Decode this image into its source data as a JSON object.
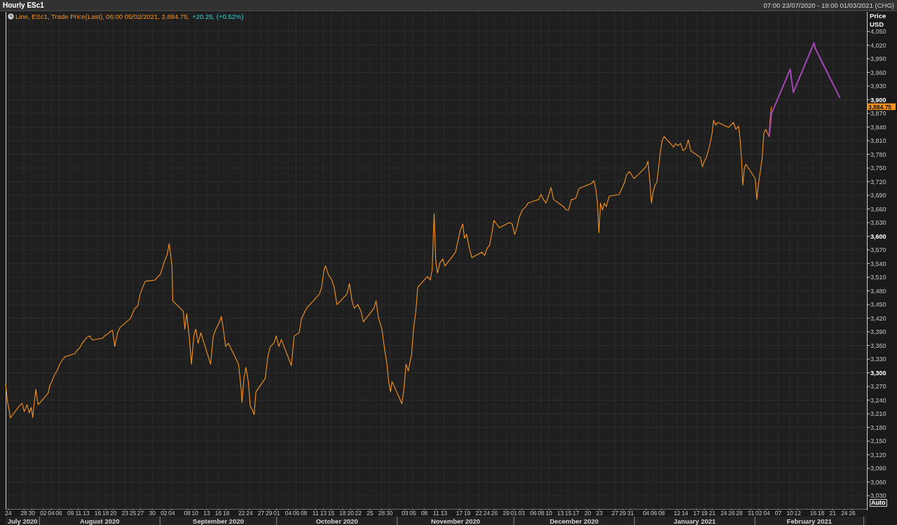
{
  "window": {
    "title": "Hourly ESc1",
    "date_range": "07:00 23/07/2020 - 19:00 01/03/2021 (CHG)"
  },
  "chart": {
    "legend": {
      "series_text": "Line, ESc1, Trade Price(Last), 06:00 05/02/2021, 3,884.75,",
      "change_text": "+20.25, (+0.52%)"
    },
    "y_axis": {
      "title": "Price",
      "unit": "USD",
      "scale_button": "Auto"
    },
    "last_price_tag": "3,884.75",
    "month_axis": [
      "July 2020",
      "August 2020",
      "September 2020",
      "October 2020",
      "November 2020",
      "December 2020",
      "January 2021",
      "February 2021"
    ],
    "chart_data": {
      "type": "line",
      "grid": true,
      "x": [
        "2020-07-23 07:00",
        "2020-07-23 19:00",
        "2020-07-24 05:00",
        "2020-07-24 12:00",
        "2020-07-26 19:00",
        "2020-07-27 12:00",
        "2020-07-28 02:00",
        "2020-07-28 19:00",
        "2020-07-29 09:00",
        "2020-07-29 21:00",
        "2020-07-30 07:00",
        "2020-07-30 17:00",
        "2020-07-31 02:00",
        "2020-07-31 07:00",
        "2020-07-31 16:00",
        "2020-08-03 05:00",
        "2020-08-03 17:00",
        "2020-08-04 05:00",
        "2020-08-04 21:00",
        "2020-08-05 12:00",
        "2020-08-06 05:00",
        "2020-08-06 19:00",
        "2020-08-07 12:00",
        "2020-08-10 02:00",
        "2020-08-10 17:00",
        "2020-08-11 09:00",
        "2020-08-12 00:00",
        "2020-08-12 17:00",
        "2020-08-13 07:00",
        "2020-08-13 21:00",
        "2020-08-14 14:00",
        "2020-08-17 05:00",
        "2020-08-17 21:00",
        "2020-08-18 12:00",
        "2020-08-19 02:00",
        "2020-08-19 19:00",
        "2020-08-20 09:00",
        "2020-08-21 02:00",
        "2020-08-21 16:00",
        "2020-08-24 09:00",
        "2020-08-25 00:00",
        "2020-08-25 14:00",
        "2020-08-26 07:00",
        "2020-08-26 21:00",
        "2020-08-27 14:00",
        "2020-08-28 05:00",
        "2020-08-30 19:00",
        "2020-08-31 12:00",
        "2020-09-01 02:00",
        "2020-09-02 00:00",
        "2020-09-02 19:00",
        "2020-09-03 09:00",
        "2020-09-04 02:00",
        "2020-09-04 07:00",
        "2020-09-07 00:00",
        "2020-09-07 09:00",
        "2020-09-07 21:00",
        "2020-09-08 12:00",
        "2020-09-09 02:00",
        "2020-09-09 17:00",
        "2020-09-10 05:00",
        "2020-09-10 19:00",
        "2020-09-11 12:00",
        "2020-09-14 00:00",
        "2020-09-14 17:00",
        "2020-09-15 09:00",
        "2020-09-16 07:00",
        "2020-09-16 19:00",
        "2020-09-17 07:00",
        "2020-09-17 21:00",
        "2020-09-18 14:00",
        "2020-09-21 05:00",
        "2020-09-21 21:00",
        "2020-09-22 02:00",
        "2020-09-22 14:00",
        "2020-09-23 02:00",
        "2020-09-23 17:00",
        "2020-09-24 05:00",
        "2020-09-24 17:00",
        "2020-09-25 05:00",
        "2020-09-25 16:00",
        "2020-09-28 02:00",
        "2020-09-28 17:00",
        "2020-09-29 09:00",
        "2020-09-30 07:00",
        "2020-09-30 21:00",
        "2020-10-01 14:00",
        "2020-10-02 05:00",
        "2020-10-04 19:00",
        "2020-10-05 12:00",
        "2020-10-06 19:00",
        "2020-10-07 09:00",
        "2020-10-08 17:00",
        "2020-10-12 00:00",
        "2020-10-12 14:00",
        "2020-10-13 05:00",
        "2020-10-13 14:00",
        "2020-10-14 07:00",
        "2020-10-15 05:00",
        "2020-10-15 19:00",
        "2020-10-16 12:00",
        "2020-10-19 02:00",
        "2020-10-19 17:00",
        "2020-10-20 09:00",
        "2020-10-21 00:00",
        "2020-10-21 21:00",
        "2020-10-22 17:00",
        "2020-10-23 07:00",
        "2020-10-26 00:00",
        "2020-10-26 14:00",
        "2020-10-27 05:00",
        "2020-10-28 02:00",
        "2020-10-28 19:00",
        "2020-10-29 09:00",
        "2020-10-29 19:00",
        "2020-10-30 07:00",
        "2020-10-30 16:00",
        "2020-11-02 05:00",
        "2020-11-02 17:00",
        "2020-11-03 07:00",
        "2020-11-03 21:00",
        "2020-11-04 17:00",
        "2020-11-05 05:00",
        "2020-11-05 19:00",
        "2020-11-06 07:00",
        "2020-11-08 19:00",
        "2020-11-09 12:00",
        "2020-11-10 00:00",
        "2020-11-10 12:00",
        "2020-11-10 21:00",
        "2020-11-11 09:00",
        "2020-11-12 00:00",
        "2020-11-12 17:00",
        "2020-11-13 07:00",
        "2020-11-16 00:00",
        "2020-11-16 14:00",
        "2020-11-17 05:00",
        "2020-11-17 21:00",
        "2020-11-18 07:00",
        "2020-11-18 21:00",
        "2020-11-19 14:00",
        "2020-11-20 05:00",
        "2020-11-22 19:00",
        "2020-11-23 12:00",
        "2020-11-24 02:00",
        "2020-11-24 19:00",
        "2020-11-25 07:00",
        "2020-11-25 21:00",
        "2020-11-26 14:00",
        "2020-11-27 07:00",
        "2020-11-29 19:00",
        "2020-11-30 14:00",
        "2020-12-01 05:00",
        "2020-12-01 19:00",
        "2020-12-02 09:00",
        "2020-12-03 05:00",
        "2020-12-04 02:00",
        "2020-12-04 16:00",
        "2020-12-07 09:00",
        "2020-12-08 00:00",
        "2020-12-08 14:00",
        "2020-12-09 07:00",
        "2020-12-09 21:00",
        "2020-12-10 14:00",
        "2020-12-11 05:00",
        "2020-12-13 19:00",
        "2020-12-14 12:00",
        "2020-12-15 02:00",
        "2020-12-15 19:00",
        "2020-12-16 09:00",
        "2020-12-17 00:00",
        "2020-12-17 17:00",
        "2020-12-18 07:00",
        "2020-12-21 00:00",
        "2020-12-21 14:00",
        "2020-12-22 02:00",
        "2020-12-22 12:00",
        "2020-12-22 21:00",
        "2020-12-23 07:00",
        "2020-12-23 19:00",
        "2020-12-24 07:00",
        "2020-12-24 19:00",
        "2020-12-25 12:00",
        "2020-12-28 02:00",
        "2020-12-28 17:00",
        "2020-12-29 09:00",
        "2020-12-30 00:00",
        "2020-12-30 17:00",
        "2020-12-31 07:00",
        "2020-12-31 21:00",
        "2021-01-01 14:00",
        "2021-01-04 00:00",
        "2021-01-04 12:00",
        "2021-01-05 00:00",
        "2021-01-05 09:00",
        "2021-01-05 19:00",
        "2021-01-06 07:00",
        "2021-01-06 19:00",
        "2021-01-07 05:00",
        "2021-01-07 17:00",
        "2021-01-08 05:00",
        "2021-01-08 16:00",
        "2021-01-11 02:00",
        "2021-01-11 14:00",
        "2021-01-12 05:00",
        "2021-01-12 21:00",
        "2021-01-13 12:00",
        "2021-01-14 05:00",
        "2021-01-14 21:00",
        "2021-01-15 12:00",
        "2021-01-18 00:00",
        "2021-01-18 12:00",
        "2021-01-19 00:00",
        "2021-01-19 12:00",
        "2021-01-20 00:00",
        "2021-01-20 12:00",
        "2021-01-21 00:00",
        "2021-01-21 09:00",
        "2021-01-21 21:00",
        "2021-01-22 14:00",
        "2021-01-25 05:00",
        "2021-01-25 21:00",
        "2021-01-26 12:00",
        "2021-01-27 02:00",
        "2021-01-27 19:00",
        "2021-01-28 05:00",
        "2021-01-28 14:00",
        "2021-01-28 21:00",
        "2021-01-29 07:00",
        "2021-01-29 16:00",
        "2021-02-01 02:00",
        "2021-02-01 12:00",
        "2021-02-01 21:00",
        "2021-02-02 09:00",
        "2021-02-02 21:00",
        "2021-02-03 07:00",
        "2021-02-03 19:00",
        "2021-02-04 05:00",
        "2021-02-04 15:00",
        "2021-02-04 23:00",
        "2021-02-05 06:00",
        "2021-02-10 02:00",
        "2021-02-10 21:00",
        "2021-02-16 05:00",
        "2021-02-16 12:00",
        "2021-02-22 21:00"
      ],
      "series": [
        {
          "color": "#f7931e",
          "values": [
            3276,
            3235,
            3219,
            3201,
            3227,
            3233,
            3215,
            3230,
            3212,
            3224,
            3202,
            3239,
            3264,
            3248,
            3230,
            3255,
            3273,
            3281,
            3296,
            3304,
            3319,
            3327,
            3335,
            3342,
            3350,
            3355,
            3365,
            3373,
            3378,
            3381,
            3372,
            3376,
            3382,
            3385,
            3390,
            3393,
            3358,
            3388,
            3399,
            3419,
            3432,
            3442,
            3447,
            3473,
            3488,
            3501,
            3504,
            3512,
            3516,
            3542,
            3558,
            3584,
            3535,
            3458,
            3435,
            3396,
            3430,
            3381,
            3319,
            3381,
            3396,
            3365,
            3388,
            3319,
            3381,
            3396,
            3412,
            3424,
            3396,
            3358,
            3365,
            3319,
            3265,
            3235,
            3288,
            3312,
            3281,
            3227,
            3219,
            3208,
            3258,
            3288,
            3335,
            3358,
            3365,
            3381,
            3358,
            3373,
            3316,
            3381,
            3388,
            3419,
            3442,
            3473,
            3488,
            3527,
            3535,
            3516,
            3504,
            3488,
            3450,
            3473,
            3496,
            3458,
            3442,
            3450,
            3435,
            3412,
            3442,
            3458,
            3419,
            3396,
            3350,
            3319,
            3281,
            3258,
            3281,
            3232,
            3265,
            3319,
            3304,
            3342,
            3396,
            3435,
            3488,
            3512,
            3504,
            3527,
            3650,
            3550,
            3519,
            3542,
            3550,
            3535,
            3565,
            3588,
            3612,
            3627,
            3596,
            3604,
            3573,
            3553,
            3565,
            3558,
            3573,
            3581,
            3604,
            3635,
            3627,
            3619,
            3630,
            3627,
            3604,
            3619,
            3642,
            3658,
            3665,
            3673,
            3681,
            3692,
            3681,
            3673,
            3688,
            3707,
            3681,
            3665,
            3658,
            3658,
            3681,
            3681,
            3685,
            3704,
            3707,
            3716,
            3722,
            3704,
            3673,
            3608,
            3673,
            3658,
            3673,
            3665,
            3688,
            3692,
            3704,
            3716,
            3735,
            3742,
            3735,
            3727,
            3732,
            3753,
            3765,
            3719,
            3673,
            3696,
            3712,
            3719,
            3750,
            3788,
            3812,
            3819,
            3796,
            3804,
            3799,
            3804,
            3788,
            3793,
            3812,
            3788,
            3773,
            3753,
            3765,
            3773,
            3788,
            3804,
            3827,
            3855,
            3845,
            3850,
            3839,
            3845,
            3850,
            3835,
            3842,
            3812,
            3765,
            3712,
            3750,
            3758,
            3727,
            3681,
            3712,
            3742,
            3773,
            3827,
            3835,
            3827,
            3819,
            3861,
            3884.75,
            null,
            null,
            null,
            null,
            null
          ]
        },
        {
          "color": "#a547b8",
          "values": [
            null,
            null,
            null,
            null,
            null,
            null,
            null,
            null,
            null,
            null,
            null,
            null,
            null,
            null,
            null,
            null,
            null,
            null,
            null,
            null,
            null,
            null,
            null,
            null,
            null,
            null,
            null,
            null,
            null,
            null,
            null,
            null,
            null,
            null,
            null,
            null,
            null,
            null,
            null,
            null,
            null,
            null,
            null,
            null,
            null,
            null,
            null,
            null,
            null,
            null,
            null,
            null,
            null,
            null,
            null,
            null,
            null,
            null,
            null,
            null,
            null,
            null,
            null,
            null,
            null,
            null,
            null,
            null,
            null,
            null,
            null,
            null,
            null,
            null,
            null,
            null,
            null,
            null,
            null,
            null,
            null,
            null,
            null,
            null,
            null,
            null,
            null,
            null,
            null,
            null,
            null,
            null,
            null,
            null,
            null,
            null,
            null,
            null,
            null,
            null,
            null,
            null,
            null,
            null,
            null,
            null,
            null,
            null,
            null,
            null,
            null,
            null,
            null,
            null,
            null,
            null,
            null,
            null,
            null,
            null,
            null,
            null,
            null,
            null,
            null,
            null,
            null,
            null,
            null,
            null,
            null,
            null,
            null,
            null,
            null,
            null,
            null,
            null,
            null,
            null,
            null,
            null,
            null,
            null,
            null,
            null,
            null,
            null,
            null,
            null,
            null,
            null,
            null,
            null,
            null,
            null,
            null,
            null,
            null,
            null,
            null,
            null,
            null,
            null,
            null,
            null,
            null,
            null,
            null,
            null,
            null,
            null,
            null,
            null,
            null,
            null,
            null,
            null,
            null,
            null,
            null,
            null,
            null,
            null,
            null,
            null,
            null,
            null,
            null,
            null,
            null,
            null,
            null,
            null,
            null,
            null,
            null,
            null,
            null,
            null,
            null,
            null,
            null,
            null,
            null,
            null,
            null,
            null,
            null,
            null,
            null,
            null,
            null,
            null,
            null,
            null,
            null,
            null,
            null,
            null,
            null,
            null,
            null,
            null,
            null,
            null,
            null,
            null,
            null,
            null,
            null,
            null,
            null,
            null,
            null,
            null,
            null,
            null,
            3819,
            3842,
            3869,
            3967,
            3916,
            4025,
            4013,
            3904
          ]
        }
      ],
      "xlim": [
        "2020-07-23 07:00",
        "2021-03-01 19:00"
      ],
      "ylim": [
        3001,
        4093
      ],
      "xticks": [
        {
          "value": "2020-07-24",
          "label": "24"
        },
        {
          "value": "2020-07-28",
          "label": "28"
        },
        {
          "value": "2020-07-30",
          "label": "30"
        },
        {
          "value": "2020-08-02",
          "label": "02"
        },
        {
          "value": "2020-08-04",
          "label": "04"
        },
        {
          "value": "2020-08-06",
          "label": "06"
        },
        {
          "value": "2020-08-09",
          "label": "09"
        },
        {
          "value": "2020-08-11",
          "label": "11"
        },
        {
          "value": "2020-08-13",
          "label": "13"
        },
        {
          "value": "2020-08-16",
          "label": "16"
        },
        {
          "value": "2020-08-18",
          "label": "18"
        },
        {
          "value": "2020-08-20",
          "label": "20"
        },
        {
          "value": "2020-08-23",
          "label": "23"
        },
        {
          "value": "2020-08-25",
          "label": "25"
        },
        {
          "value": "2020-08-27",
          "label": "27"
        },
        {
          "value": "2020-08-30",
          "label": "30"
        },
        {
          "value": "2020-09-02",
          "label": "02"
        },
        {
          "value": "2020-09-04",
          "label": "04"
        },
        {
          "value": "2020-09-08",
          "label": "08"
        },
        {
          "value": "2020-09-10",
          "label": "10"
        },
        {
          "value": "2020-09-13",
          "label": "13"
        },
        {
          "value": "2020-09-16",
          "label": "16"
        },
        {
          "value": "2020-09-18",
          "label": "18"
        },
        {
          "value": "2020-09-22",
          "label": "22"
        },
        {
          "value": "2020-09-24",
          "label": "24"
        },
        {
          "value": "2020-09-27",
          "label": "27"
        },
        {
          "value": "2020-09-29",
          "label": "29"
        },
        {
          "value": "2020-10-01",
          "label": "01"
        },
        {
          "value": "2020-10-04",
          "label": "04"
        },
        {
          "value": "2020-10-06",
          "label": "06"
        },
        {
          "value": "2020-10-08",
          "label": "08"
        },
        {
          "value": "2020-10-11",
          "label": "11"
        },
        {
          "value": "2020-10-13",
          "label": "13"
        },
        {
          "value": "2020-10-15",
          "label": "15"
        },
        {
          "value": "2020-10-18",
          "label": "18"
        },
        {
          "value": "2020-10-20",
          "label": "20"
        },
        {
          "value": "2020-10-22",
          "label": "22"
        },
        {
          "value": "2020-10-25",
          "label": "25"
        },
        {
          "value": "2020-10-28",
          "label": "28"
        },
        {
          "value": "2020-10-30",
          "label": "30"
        },
        {
          "value": "2020-11-03",
          "label": "03"
        },
        {
          "value": "2020-11-05",
          "label": "05"
        },
        {
          "value": "2020-11-08",
          "label": "08"
        },
        {
          "value": "2020-11-11",
          "label": "11"
        },
        {
          "value": "2020-11-13",
          "label": "13"
        },
        {
          "value": "2020-11-17",
          "label": "17"
        },
        {
          "value": "2020-11-19",
          "label": "19"
        },
        {
          "value": "2020-11-22",
          "label": "22"
        },
        {
          "value": "2020-11-24",
          "label": "24"
        },
        {
          "value": "2020-11-26",
          "label": "26"
        },
        {
          "value": "2020-11-29",
          "label": "29"
        },
        {
          "value": "2020-12-01",
          "label": "01"
        },
        {
          "value": "2020-12-03",
          "label": "03"
        },
        {
          "value": "2020-12-06",
          "label": "06"
        },
        {
          "value": "2020-12-08",
          "label": "08"
        },
        {
          "value": "2020-12-10",
          "label": "10"
        },
        {
          "value": "2020-12-13",
          "label": "13"
        },
        {
          "value": "2020-12-15",
          "label": "15"
        },
        {
          "value": "2020-12-17",
          "label": "17"
        },
        {
          "value": "2020-12-20",
          "label": "20"
        },
        {
          "value": "2020-12-23",
          "label": "23"
        },
        {
          "value": "2020-12-27",
          "label": "27"
        },
        {
          "value": "2020-12-29",
          "label": "29"
        },
        {
          "value": "2020-12-31",
          "label": "31"
        },
        {
          "value": "2021-01-04",
          "label": "04"
        },
        {
          "value": "2021-01-06",
          "label": "06"
        },
        {
          "value": "2021-01-08",
          "label": "08"
        },
        {
          "value": "2021-01-12",
          "label": "12"
        },
        {
          "value": "2021-01-14",
          "label": "14"
        },
        {
          "value": "2021-01-17",
          "label": "17"
        },
        {
          "value": "2021-01-19",
          "label": "19"
        },
        {
          "value": "2021-01-21",
          "label": "21"
        },
        {
          "value": "2021-01-24",
          "label": "24"
        },
        {
          "value": "2021-01-26",
          "label": "26"
        },
        {
          "value": "2021-01-28",
          "label": "28"
        },
        {
          "value": "2021-01-31",
          "label": "31"
        },
        {
          "value": "2021-02-02",
          "label": "02"
        },
        {
          "value": "2021-02-04",
          "label": "04"
        },
        {
          "value": "2021-02-07",
          "label": "07"
        },
        {
          "value": "2021-02-10",
          "label": "10"
        },
        {
          "value": "2021-02-12",
          "label": "12"
        },
        {
          "value": "2021-02-16",
          "label": "16"
        },
        {
          "value": "2021-02-18",
          "label": "18"
        },
        {
          "value": "2021-02-21",
          "label": "21"
        },
        {
          "value": "2021-02-24",
          "label": "24"
        },
        {
          "value": "2021-02-26",
          "label": "26"
        }
      ],
      "yticks": [
        {
          "value": 3030,
          "label": "3,030"
        },
        {
          "value": 3060,
          "label": "3,060"
        },
        {
          "value": 3090,
          "label": "3,090"
        },
        {
          "value": 3120,
          "label": "3,120"
        },
        {
          "value": 3150,
          "label": "3,150"
        },
        {
          "value": 3180,
          "label": "3,180"
        },
        {
          "value": 3210,
          "label": "3,210"
        },
        {
          "value": 3240,
          "label": "3,240"
        },
        {
          "value": 3270,
          "label": "3,270"
        },
        {
          "value": 3300,
          "label": "3,300"
        },
        {
          "value": 3330,
          "label": "3,330"
        },
        {
          "value": 3360,
          "label": "3,360"
        },
        {
          "value": 3390,
          "label": "3,390"
        },
        {
          "value": 3420,
          "label": "3,420"
        },
        {
          "value": 3450,
          "label": "3,450"
        },
        {
          "value": 3480,
          "label": "3,480"
        },
        {
          "value": 3510,
          "label": "3,510"
        },
        {
          "value": 3540,
          "label": "3,540"
        },
        {
          "value": 3570,
          "label": "3,570"
        },
        {
          "value": 3600,
          "label": "3,600"
        },
        {
          "value": 3630,
          "label": "3,630"
        },
        {
          "value": 3660,
          "label": "3,660"
        },
        {
          "value": 3690,
          "label": "3,690"
        },
        {
          "value": 3720,
          "label": "3,720"
        },
        {
          "value": 3750,
          "label": "3,750"
        },
        {
          "value": 3780,
          "label": "3,780"
        },
        {
          "value": 3810,
          "label": "3,810"
        },
        {
          "value": 3840,
          "label": "3,840"
        },
        {
          "value": 3870,
          "label": "3,870"
        },
        {
          "value": 3900,
          "label": "3,900"
        },
        {
          "value": 3930,
          "label": "3,930"
        },
        {
          "value": 3960,
          "label": "3,960"
        },
        {
          "value": 3990,
          "label": "3,990"
        },
        {
          "value": 4020,
          "label": "4,020"
        },
        {
          "value": 4050,
          "label": "4,050"
        }
      ]
    }
  }
}
